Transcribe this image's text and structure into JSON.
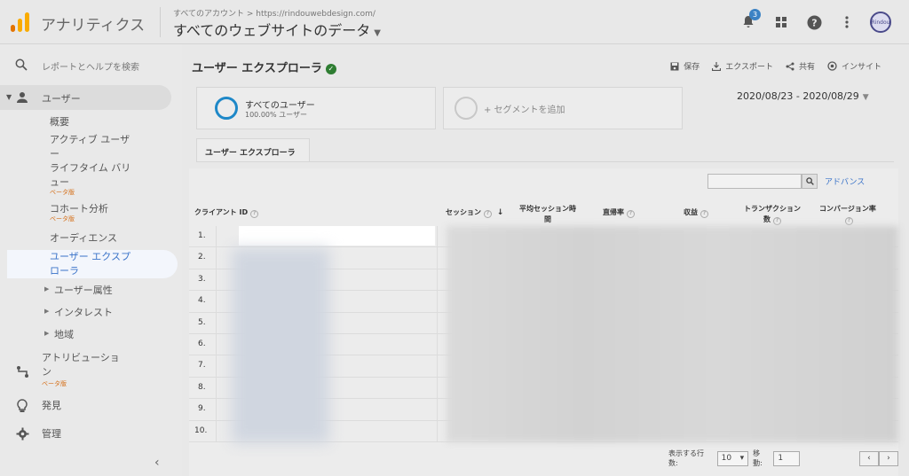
{
  "header": {
    "app_title": "アナリティクス",
    "account_crumb": "すべてのアカウント > https://rindouwebdesign.com/",
    "view_name": "すべてのウェブサイトのデータ",
    "notification_count": "3",
    "avatar_text": "Rindou"
  },
  "sidebar": {
    "search_label": "レポートとヘルプを検索",
    "user_section": "ユーザー",
    "items": {
      "overview": "概要",
      "active_users_1": "アクティブ ユーザ",
      "active_users_2": "ー",
      "lifetime_1": "ライフタイム バリ",
      "lifetime_2": "ュー",
      "beta1": "ベータ版",
      "cohort": "コホート分析",
      "beta2": "ベータ版",
      "audiences": "オーディエンス",
      "explorer_1": "ユーザー エクスプ",
      "explorer_2": "ローラ",
      "attributes": "ユーザー属性",
      "interests": "インタレスト",
      "geo": "地域"
    },
    "attribution_1": "アトリビューショ",
    "attribution_2": "ン",
    "beta3": "ベータ版",
    "discover": "発見",
    "admin": "管理",
    "collapse": "‹"
  },
  "main": {
    "title": "ユーザー エクスプローラ",
    "actions": {
      "save": "保存",
      "export": "エクスポート",
      "share": "共有",
      "insights": "インサイト"
    },
    "segment1_name": "すべてのユーザー",
    "segment1_sub": "100.00% ユーザー",
    "segment_add": "+ セグメントを追加",
    "date_range": "2020/08/23 - 2020/08/29",
    "tab": "ユーザー エクスプローラ",
    "advanced": "アドバンス",
    "columns": {
      "client_id": "クライアント ID",
      "sessions": "セッション",
      "avg_session_1": "平均セッション時",
      "avg_session_2": "間",
      "bounce": "直帰率",
      "revenue": "収益",
      "transactions_1": "トランザクション",
      "transactions_2": "数",
      "conversion": "コンバージョン率"
    },
    "rows": [
      "1.",
      "2.",
      "3.",
      "4.",
      "5.",
      "6.",
      "7.",
      "8.",
      "9.",
      "10."
    ],
    "pager": {
      "rows_label": "表示する行数:",
      "rows_value": "10",
      "goto_label": "移動:",
      "goto_value": "1"
    }
  },
  "colors": {
    "accent": "#3a73c9",
    "beta": "#d5701a",
    "logo_orange": "#f9ab00",
    "logo_dark": "#e37400"
  }
}
